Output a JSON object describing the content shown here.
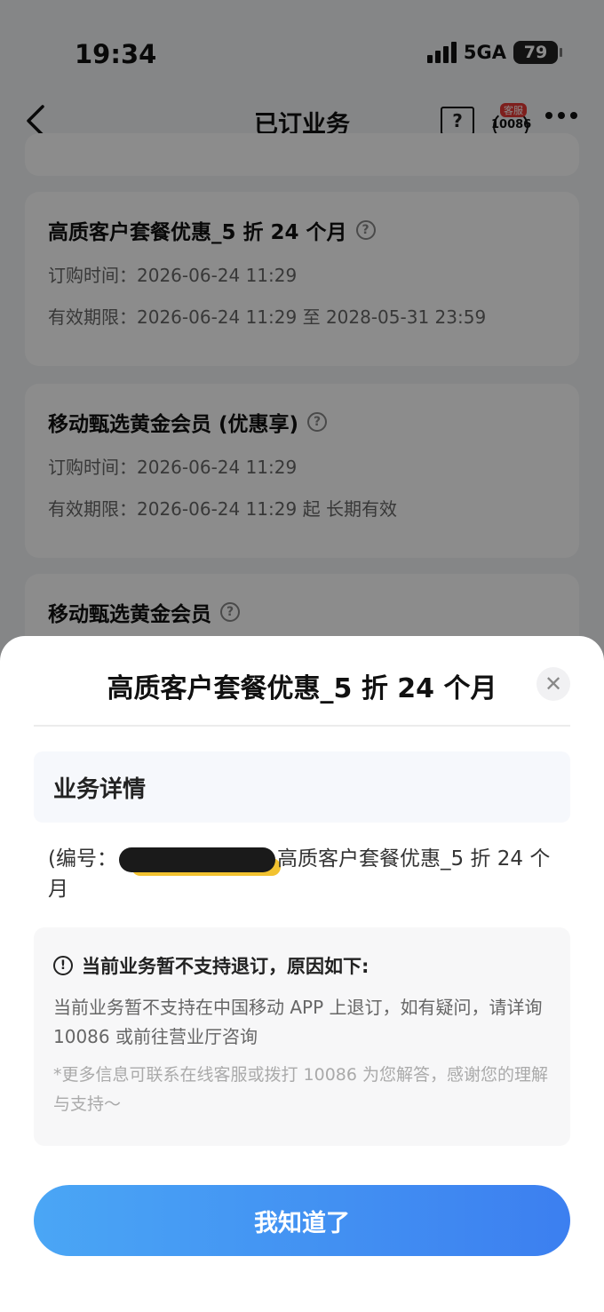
{
  "status_bar": {
    "time": "19:34",
    "network": "5GA",
    "battery": "79"
  },
  "nav": {
    "title": "已订业务",
    "help_icon": "?",
    "service_badge": "客服",
    "service_number": "10086"
  },
  "cards": [
    {
      "title": "高质客户套餐优惠_5 折 24 个月",
      "order_time": "订购时间：2026-06-24 11:29",
      "validity": "有效期限：2026-06-24 11:29 至 2028-05-31 23:59"
    },
    {
      "title": "移动甄选黄金会员 (优惠享)",
      "order_time": "订购时间：2026-06-24 11:29",
      "validity": "有效期限：2026-06-24 11:29 起 长期有效"
    },
    {
      "title": "移动甄选黄金会员"
    }
  ],
  "sheet": {
    "title": "高质客户套餐优惠_5 折 24 个月",
    "close_icon": "✕",
    "section_title": "业务详情",
    "biz_prefix": "(编号：",
    "biz_suffix": "高质客户套餐优惠_5 折 24 个月",
    "notice_title": "当前业务暂不支持退订，原因如下:",
    "notice_body": "当前业务暂不支持在中国移动 APP 上退订，如有疑问，请详询 10086 或前往营业厅咨询",
    "notice_tip": "*更多信息可联系在线客服或拨打 10086 为您解答，感谢您的理解与支持～",
    "confirm_label": "我知道了"
  }
}
